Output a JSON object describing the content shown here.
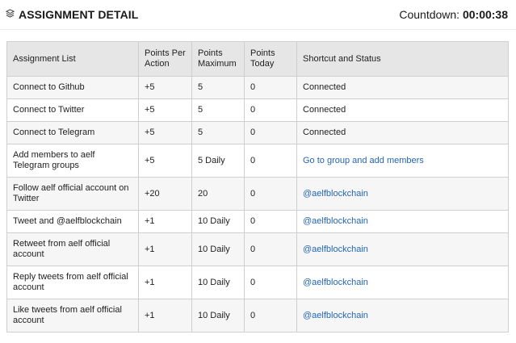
{
  "header": {
    "icon": "layers-icon",
    "title": "ASSIGNMENT DETAIL",
    "countdown_label": "Countdown:",
    "countdown_value": "00:00:38"
  },
  "table": {
    "columns": [
      "Assignment List",
      "Points Per Action",
      "Points Maximum",
      "Points Today",
      "Shortcut and Status"
    ],
    "rows": [
      {
        "task": "Connect to Github",
        "per_action": "+5",
        "maximum": "5",
        "today": "0",
        "status": "Connected",
        "is_link": false
      },
      {
        "task": "Connect to Twitter",
        "per_action": "+5",
        "maximum": "5",
        "today": "0",
        "status": "Connected",
        "is_link": false
      },
      {
        "task": "Connect to Telegram",
        "per_action": "+5",
        "maximum": "5",
        "today": "0",
        "status": "Connected",
        "is_link": false
      },
      {
        "task": "Add members to aelf Telegram groups",
        "per_action": "+5",
        "maximum": "5 Daily",
        "today": "0",
        "status": "Go to group and add members",
        "is_link": true
      },
      {
        "task": "Follow aelf official account on Twitter",
        "per_action": "+20",
        "maximum": "20",
        "today": "0",
        "status": "@aelfblockchain",
        "is_link": true
      },
      {
        "task": "Tweet and @aelfblockchain",
        "per_action": "+1",
        "maximum": "10 Daily",
        "today": "0",
        "status": "@aelfblockchain",
        "is_link": true
      },
      {
        "task": "Retweet from aelf official account",
        "per_action": "+1",
        "maximum": "10 Daily",
        "today": "0",
        "status": "@aelfblockchain",
        "is_link": true
      },
      {
        "task": "Reply tweets from aelf official account",
        "per_action": "+1",
        "maximum": "10 Daily",
        "today": "0",
        "status": "@aelfblockchain",
        "is_link": true
      },
      {
        "task": "Like tweets from aelf official account",
        "per_action": "+1",
        "maximum": "10 Daily",
        "today": "0",
        "status": "@aelfblockchain",
        "is_link": true
      }
    ]
  },
  "colors": {
    "link": "#2466b3",
    "header_bg": "#e6e6e6",
    "row_alt": "#f6f6f6",
    "border": "#cfcfcf"
  }
}
